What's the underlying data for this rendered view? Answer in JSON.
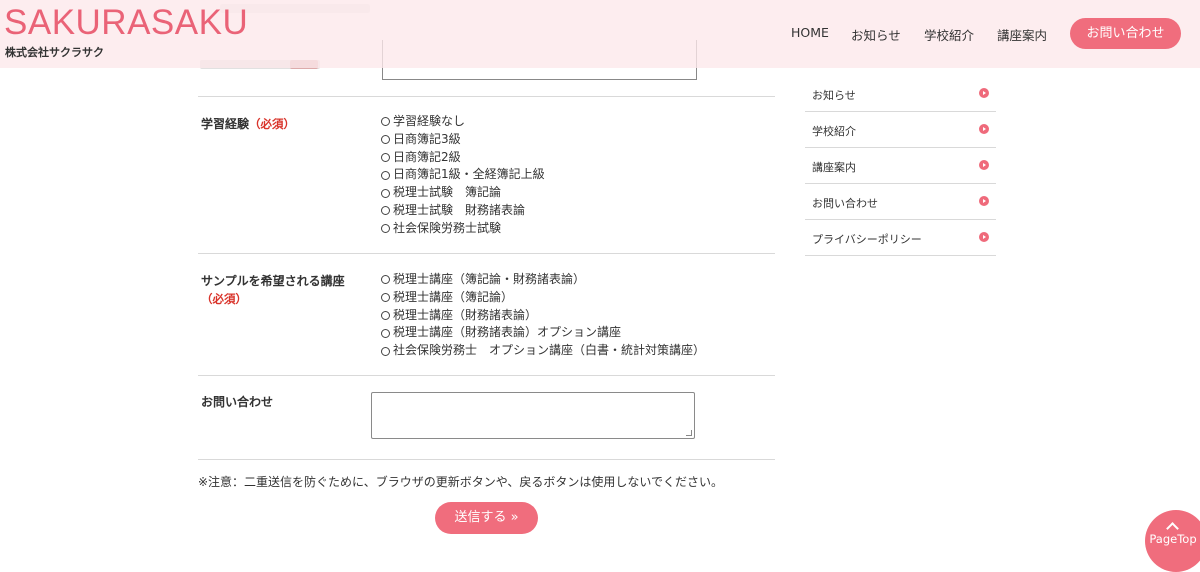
{
  "header": {
    "logo": "SAKURASAKU",
    "company": "株式会社サクラサク",
    "nav": [
      "HOME",
      "お知らせ",
      "学校紹介",
      "講座案内"
    ],
    "contact_button": "お問い合わせ"
  },
  "form": {
    "required_mark": "（必須）",
    "experience": {
      "label": "学習経験",
      "options": [
        "学習経験なし",
        "日商簿記3級",
        "日商簿記2級",
        "日商簿記1級・全経簿記上級",
        "税理士試験　簿記論",
        "税理士試験　財務諸表論",
        "社会保険労務士試験"
      ]
    },
    "sample": {
      "label": "サンプルを希望される講座",
      "options": [
        "税理士講座（簿記論・財務諸表論）",
        "税理士講座（簿記論）",
        "税理士講座（財務諸表論）",
        "税理士講座（財務諸表論）オプション講座",
        "社会保険労務士　オプション講座（白書・統計対策講座）"
      ]
    },
    "inquiry": {
      "label": "お問い合わせ",
      "value": ""
    },
    "notice": "※注意：二重送信を防ぐために、ブラウザの更新ボタンや、戻るボタンは使用しないでください。",
    "submit": "送信する »"
  },
  "sidebar": {
    "items": [
      "お知らせ",
      "学校紹介",
      "講座案内",
      "お問い合わせ",
      "プライバシーポリシー"
    ]
  },
  "pagetop": "PageTop"
}
